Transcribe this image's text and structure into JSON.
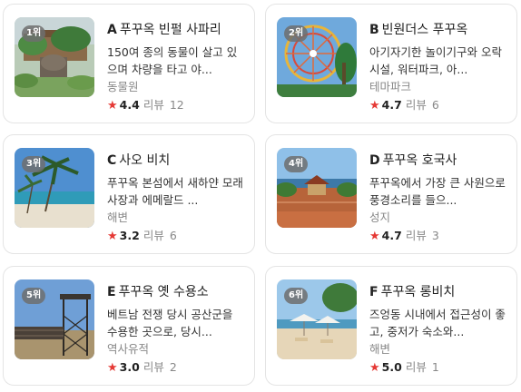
{
  "places": [
    {
      "rank": "1위",
      "letter": "A",
      "name": "푸꾸옥 빈펄 사파리",
      "desc": "150여 종의 동물이 살고 있으며 차량을 타고 야...",
      "category": "동물원",
      "score": "4.4",
      "review_label": "리뷰",
      "review_count": "12",
      "image": "safari-photo"
    },
    {
      "rank": "2위",
      "letter": "B",
      "name": "빈원더스 푸꾸옥",
      "desc": "아기자기한 놀이기구와 오락시설, 워터파크, 아...",
      "category": "테마파크",
      "score": "4.7",
      "review_label": "리뷰",
      "review_count": "6",
      "image": "ferris-wheel-photo"
    },
    {
      "rank": "3위",
      "letter": "C",
      "name": "사오 비치",
      "desc": "푸꾸옥 본섬에서 새하얀 모래사장과 에메랄드 ...",
      "category": "해변",
      "score": "3.2",
      "review_label": "리뷰",
      "review_count": "6",
      "image": "beach-palm-photo"
    },
    {
      "rank": "4위",
      "letter": "D",
      "name": "푸꾸옥 호국사",
      "desc": "푸꾸옥에서 가장 큰 사원으로 풍경소리를 들으...",
      "category": "성지",
      "score": "4.7",
      "review_label": "리뷰",
      "review_count": "3",
      "image": "temple-photo"
    },
    {
      "rank": "5위",
      "letter": "E",
      "name": "푸꾸옥 옛 수용소",
      "desc": "베트남 전쟁 당시 공산군을 수용한 곳으로, 당시...",
      "category": "역사유적",
      "score": "3.0",
      "review_label": "리뷰",
      "review_count": "2",
      "image": "prison-tower-photo"
    },
    {
      "rank": "6위",
      "letter": "F",
      "name": "푸꾸옥 롱비치",
      "desc": "즈엉동 시내에서 접근성이 좋고, 중저가 숙소와...",
      "category": "해변",
      "score": "5.0",
      "review_label": "리뷰",
      "review_count": "1",
      "image": "long-beach-photo"
    }
  ],
  "colors": {
    "star": "#e53935",
    "badge": "#6e6e6e",
    "border": "#e4e4e4"
  }
}
